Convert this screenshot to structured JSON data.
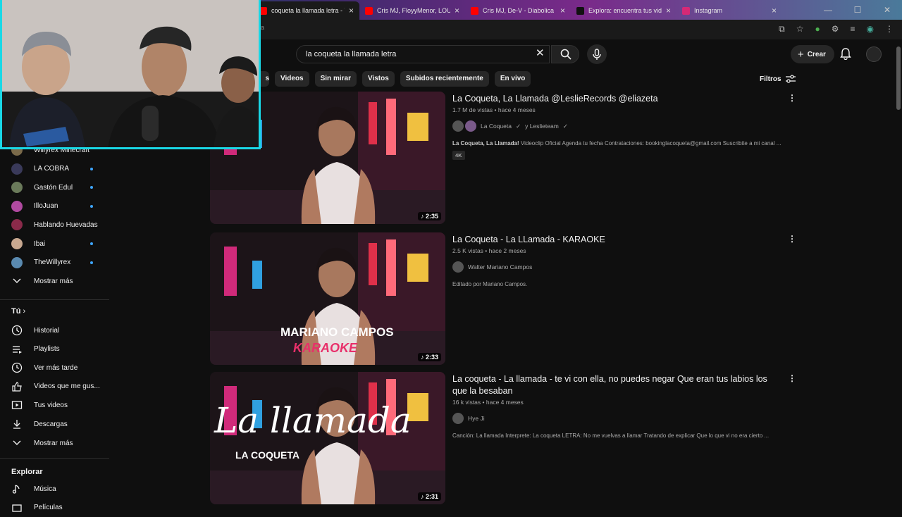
{
  "browser": {
    "tabs": [
      {
        "label": "coqueta la llamada letra - Yo",
        "color": "#ff0000",
        "active": true
      },
      {
        "label": "Cris MJ, FloyyMenor, LOUKI - D",
        "color": "#ff0000",
        "active": false
      },
      {
        "label": "Cris MJ, De-V - Diabolica (Vis",
        "color": "#ff0000",
        "active": false
      },
      {
        "label": "Explora: encuentra tus videos f",
        "color": "#111111",
        "active": false
      },
      {
        "label": "Instagram",
        "color": "#d62976",
        "active": false
      }
    ],
    "url": "a"
  },
  "header": {
    "search_value": "la coqueta la llamada letra",
    "create_label": "Crear"
  },
  "chips": [
    "s",
    "Videos",
    "Sin mirar",
    "Vistos",
    "Subidos recientemente",
    "En vivo"
  ],
  "filters_label": "Filtros",
  "sidebar": {
    "subscriptions": [
      {
        "label": "Willyrex Minecraft",
        "color": "#7a6a4a",
        "dot": false
      },
      {
        "label": "LA COBRA",
        "color": "#3a3a5a",
        "dot": true
      },
      {
        "label": "Gastón Edul",
        "color": "#6a7a5a",
        "dot": true
      },
      {
        "label": "IlloJuan",
        "color": "#b04aa0",
        "dot": true
      },
      {
        "label": "Hablando Huevadas",
        "color": "#8a2a4a",
        "dot": false
      },
      {
        "label": "Ibai",
        "color": "#c8a890",
        "dot": true
      },
      {
        "label": "TheWillyrex",
        "color": "#5a8ab0",
        "dot": true
      }
    ],
    "show_more_1": "Mostrar más",
    "you_heading": "Tú",
    "you_items": [
      {
        "label": "Historial",
        "icon": "history-icon"
      },
      {
        "label": "Playlists",
        "icon": "playlists-icon"
      },
      {
        "label": "Ver más tarde",
        "icon": "watch-later-icon"
      },
      {
        "label": "Videos que me gus...",
        "icon": "like-icon"
      },
      {
        "label": "Tus videos",
        "icon": "your-videos-icon"
      },
      {
        "label": "Descargas",
        "icon": "download-icon"
      }
    ],
    "show_more_2": "Mostrar más",
    "explore_heading": "Explorar",
    "explore_items": [
      {
        "label": "Música",
        "icon": "music-icon"
      },
      {
        "label": "Películas",
        "icon": "movies-icon"
      }
    ]
  },
  "videos": [
    {
      "title": "La Coqueta, La Llamada @LeslieRecords @eliazeta",
      "views": "1.7 M de vistas",
      "age": "hace 4 meses",
      "channel": "La Coqueta",
      "channel_extra": "y Leslieteam",
      "desc_bold": "La Coqueta, La Llamada!",
      "desc": " Videoclip Oficial Agenda tu fecha Contrataciones: bookinglacoqueta@gmail.com Suscribite a mi canal ...",
      "badge": "4K",
      "duration": "2:35",
      "thumb_text": "",
      "thumb_sub": ""
    },
    {
      "title": "La Coqueta - La LLamada - KARAOKE",
      "views": "2.5 K vistas",
      "age": "hace 2 meses",
      "channel": "Walter Mariano Campos",
      "channel_extra": "",
      "desc_bold": "",
      "desc": "Editado por Mariano Campos.",
      "badge": "",
      "duration": "2:33",
      "thumb_text": "MARIANO CAMPOS",
      "thumb_sub": "KARAOKE"
    },
    {
      "title": "La coqueta - La llamada - te vi con ella, no puedes negar Que eran tus labios los que la besaban",
      "views": "16 k vistas",
      "age": "hace 4 meses",
      "channel": "Hye Ji",
      "channel_extra": "",
      "desc_bold": "",
      "desc": "Canción: La llamada Interprete: La coqueta LETRA: No me vuelvas a llamar Tratando de explicar Que lo que vi no era cierto ...",
      "badge": "",
      "duration": "2:31",
      "thumb_text": "La llamada",
      "thumb_sub": "LA COQUETA"
    }
  ]
}
